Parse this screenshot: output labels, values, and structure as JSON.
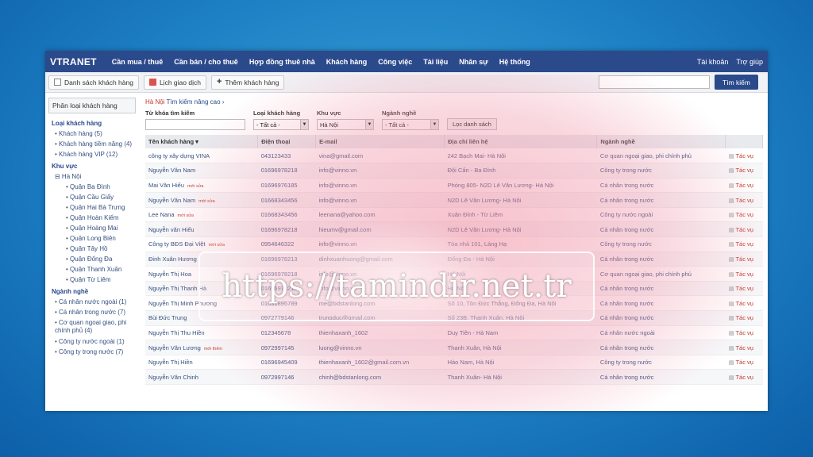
{
  "nav": {
    "brand": "VTRANET",
    "items": [
      "Cần mua / thuê",
      "Cần bán / cho thuê",
      "Hợp đồng thuê nhà",
      "Khách hàng",
      "Công việc",
      "Tài liệu",
      "Nhân sự",
      "Hệ thống"
    ],
    "right": [
      "Tài khoản",
      "Trợ giúp"
    ]
  },
  "toolbar": {
    "list_label": "Danh sách khách hàng",
    "calendar_label": "Lịch giao dịch",
    "add_label": "Thêm khách hàng",
    "search_value": "",
    "search_button": "Tìm kiếm"
  },
  "sidebar": {
    "title": "Phân loại khách hàng",
    "groups": [
      {
        "heading": "Loại khách hàng",
        "items": [
          "Khách hàng (5)",
          "Khách hàng tiềm năng (4)",
          "Khách hàng VIP (12)"
        ]
      },
      {
        "heading": "Khu vực",
        "tree": "⊟ Hà Nội",
        "items": [
          "Quận Ba Đình",
          "Quận Cầu Giấy",
          "Quận Hai Bà Trưng",
          "Quận Hoàn Kiếm",
          "Quận Hoàng Mai",
          "Quận Long Biên",
          "Quận Tây Hồ",
          "Quận Đống Đa",
          "Quận Thanh Xuân",
          "Quận Từ Liêm"
        ]
      },
      {
        "heading": "Ngành nghề",
        "items": [
          "Cá nhân nước ngoài (1)",
          "Cá nhân trong nước (7)",
          "Cơ quan ngoại giao, phi chính phủ (4)",
          "Công ty nước ngoài (1)",
          "Công ty trong nước (7)"
        ]
      }
    ]
  },
  "main": {
    "crumb_location": "Hà Nội",
    "crumb_link": "Tìm kiếm nâng cao ›",
    "filters": {
      "keyword_label": "Từ khóa tìm kiếm",
      "type_label": "Loại khách hàng",
      "type_value": "- Tất cả -",
      "area_label": "Khu vực",
      "area_value": "Hà Nội",
      "industry_label": "Ngành nghề",
      "industry_value": "- Tất cả -",
      "filter_button": "Lọc danh sách"
    },
    "columns": [
      "Tên khách hàng ▾",
      "Điện thoại",
      "E-mail",
      "Địa chỉ liên hệ",
      "Ngành nghề",
      ""
    ],
    "rows": [
      {
        "name": "công ty xây dựng VINA",
        "badge": "",
        "phone": "043123433",
        "email": "vina@gmail.com",
        "address": "242 Bạch Mai- Hà Nội",
        "industry": "Cơ quan ngoại giao, phi chính phủ",
        "action": "Tác vụ"
      },
      {
        "name": "Nguyễn Văn Nam",
        "badge": "",
        "phone": "01696978218",
        "email": "info@vinno.vn",
        "address": "Đội Cấn - Ba Đình",
        "industry": "Công ty trong nước",
        "action": "Tác vụ"
      },
      {
        "name": "Mai Văn Hiếu",
        "badge": "mới sửa",
        "phone": "01696976185",
        "email": "info@vinno.vn",
        "address": "Phòng 805- N2D Lê Văn Lương- Hà Nội",
        "industry": "Cá nhân trong nước",
        "action": "Tác vụ"
      },
      {
        "name": "Nguyễn Văn Nam",
        "badge": "mới sửa",
        "phone": "01668343456",
        "email": "info@vinno.vn",
        "address": "N2D Lê Văn Lương- Hà Nội",
        "industry": "Cá nhân trong nước",
        "action": "Tác vụ"
      },
      {
        "name": "Lee Nana",
        "badge": "mới sửa",
        "phone": "01668343456",
        "email": "leenana@yahoo.com",
        "address": "Xuân Đỉnh - Từ Liêm",
        "industry": "Công ty nước ngoài",
        "action": "Tác vụ"
      },
      {
        "name": "Nguyễn văn Hiếu",
        "badge": "",
        "phone": "01696978218",
        "email": "hieumv@gmail.com",
        "address": "N2D Lê Văn Lương- Hà Nội",
        "industry": "Cá nhân trong nước",
        "action": "Tác vụ"
      },
      {
        "name": "Công ty BĐS Đại Việt",
        "badge": "mới sửa",
        "phone": "0954646322",
        "email": "info@vinno.vn",
        "address": "Tòa nhà 101, Láng Hạ",
        "industry": "Công ty trong nước",
        "action": "Tác vụ"
      },
      {
        "name": "Đinh Xuân Hương",
        "badge": "",
        "phone": "01696978213",
        "email": "dinhxuanhuong@gmail.com",
        "address": "Đống Đa - Hà Nội",
        "industry": "Cá nhân trong nước",
        "action": "Tác vụ"
      },
      {
        "name": "Nguyễn Thị Hoa",
        "badge": "",
        "phone": "01696978218",
        "email": "info@vinno.vn",
        "address": "Hà Nội",
        "industry": "Cơ quan ngoại giao, phi chính phủ",
        "action": "Tác vụ"
      },
      {
        "name": "Nguyễn Thị Thanh Hà",
        "badge": "",
        "phone": "01696978218",
        "email": "info@vinno.vn",
        "address": "Hà Nội",
        "industry": "Cá nhân trong nước",
        "action": "Tác vụ"
      },
      {
        "name": "Nguyễn Thị Minh Phương",
        "badge": "",
        "phone": "01699895789",
        "email": "me@bdstanlong.com",
        "address": "Số 10, Tôn Đức Thắng, Đống Đa, Hà Nội",
        "industry": "Cá nhân trong nước",
        "action": "Tác vụ"
      },
      {
        "name": "Bùi Đức Trung",
        "badge": "",
        "phone": "0972779146",
        "email": "trungduc@gmail.com",
        "address": "Số 23B, Thanh Xuân, Hà Nội",
        "industry": "Cá nhân trong nước",
        "action": "Tác vụ"
      },
      {
        "name": "Nguyễn Thị Thu Hiền",
        "badge": "",
        "phone": "012345678",
        "email": "thienhaxanh_1602",
        "address": "Duy Tiên - Hà Nam",
        "industry": "Cá nhân nước ngoài",
        "action": "Tác vụ"
      },
      {
        "name": "Nguyễn Văn Lương",
        "badge": "mới thêm",
        "phone": "0972997145",
        "email": "luong@vinno.vn",
        "address": "Thanh Xuân, Hà Nội",
        "industry": "Cá nhân trong nước",
        "action": "Tác vụ"
      },
      {
        "name": "Nguyễn Thị Hiền",
        "badge": "",
        "phone": "01696945409",
        "email": "thienhaxanh_1602@gmail.com.vn",
        "address": "Hào Nam, Hà Nội",
        "industry": "Công ty trong nước",
        "action": "Tác vụ"
      },
      {
        "name": "Nguyễn Văn Chinh",
        "badge": "",
        "phone": "0972997146",
        "email": "chinh@bdstanlong.com",
        "address": "Thanh Xuân- Hà Nội",
        "industry": "Cá nhân trong nước",
        "action": "Tác vụ"
      }
    ]
  },
  "watermark": "https://tamindir.net.tr"
}
